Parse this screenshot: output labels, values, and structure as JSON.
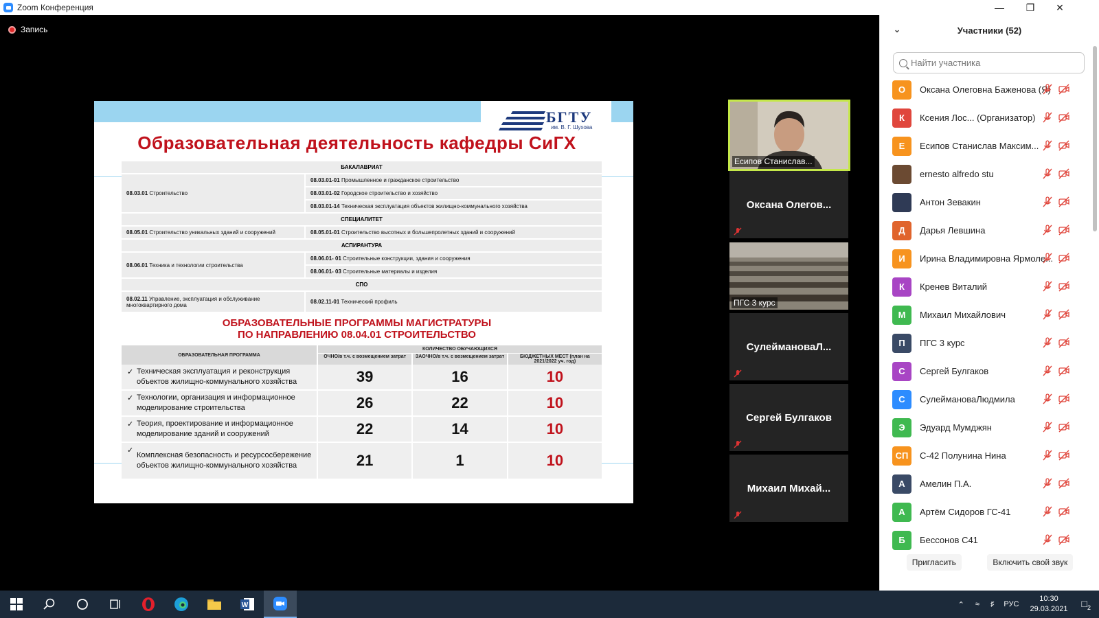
{
  "window": {
    "title": "Zoom Конференция"
  },
  "recording": {
    "label": "Запись"
  },
  "slide": {
    "logo_name": "БГТУ",
    "logo_sub": "им. В. Г. Шухова",
    "title": "Образовательная деятельность кафедры СиГХ",
    "sections": {
      "bachelor": "БАКАЛАВРИАТ",
      "specialist": "СПЕЦИАЛИТЕТ",
      "postgrad": "АСПИРАНТУРА",
      "spo": "СПО"
    },
    "bachelor": {
      "left": {
        "code": "08.03.01",
        "name": "Строительство"
      },
      "right": [
        {
          "code": "08.03.01-01",
          "name": "Промышленное и гражданское строительство"
        },
        {
          "code": "08.03.01-02",
          "name": "Городское строительство и хозяйство"
        },
        {
          "code": "08.03.01-14",
          "name": "Техническая эксплуатация объектов жилищно-коммунального хозяйства"
        }
      ]
    },
    "specialist": {
      "left": {
        "code": "08.05.01",
        "name": "Строительство уникальных зданий и сооружений"
      },
      "right": [
        {
          "code": "08.05.01-01",
          "name": "Строительство высотных и большепролетных зданий и сооружений"
        }
      ]
    },
    "postgrad": {
      "left": {
        "code": "08.06.01",
        "name": "Техника и технологии строительства"
      },
      "right": [
        {
          "code": "08.06.01- 01",
          "name": "Строительные конструкции, здания и сооружения"
        },
        {
          "code": "08.06.01- 03",
          "name": "Строительные материалы и изделия"
        }
      ]
    },
    "spo": {
      "left": {
        "code": "08.02.11",
        "name": "Управление, эксплуатация и обслуживание многоквартирного дома"
      },
      "right": [
        {
          "code": "08.02.11-01",
          "name": "Технический профиль"
        }
      ]
    },
    "subtitle_line1": "ОБРАЗОВАТЕЛЬНЫЕ ПРОГРАММЫ МАГИСТРАТУРЫ",
    "subtitle_line2": "ПО НАПРАВЛЕНИЮ 08.04.01 СТРОИТЕЛЬСТВО",
    "masters_table": {
      "col_program": "ОБРАЗОВАТЕЛЬНАЯ ПРОГРАММА",
      "col_group": "КОЛИЧЕСТВО ОБУЧАЮЩИХСЯ",
      "col_full": "ОЧНО/в т.ч. с возмещением затрат",
      "col_part": "ЗАОЧНО/в т.ч. с возмещением затрат",
      "col_budget": "БЮДЖЕТНЫХ МЕСТ (план на 2021/2022 уч. год)",
      "rows": [
        {
          "program": "Техническая эксплуатация и реконструкция объектов жилищно-коммунального хозяйства",
          "full": "39",
          "part": "16",
          "budget": "10"
        },
        {
          "program": "Технологии, организация и информационное моделирование строительства",
          "full": "26",
          "part": "22",
          "budget": "10"
        },
        {
          "program": "Теория, проектирование и информационное моделирование зданий и сооружений",
          "full": "22",
          "part": "14",
          "budget": "10"
        },
        {
          "program": "Комплексная безопасность и ресурсосбережение объектов жилищно-коммунального хозяйства",
          "full": "21",
          "part": "1",
          "budget": "10"
        }
      ]
    }
  },
  "tiles": {
    "active_label": "Есипов Станислав...",
    "t2": "Оксана  Олегов...",
    "t3_label": "ПГС 3 курс",
    "t4": "СулеймановаЛ...",
    "t5": "Сергей Булгаков",
    "t6": "Михаил  Михай..."
  },
  "participants_panel": {
    "title": "Участники (52)",
    "search_placeholder": "Найти участника",
    "invite": "Пригласить",
    "unmute": "Включить свой звук",
    "list": [
      {
        "initial": "О",
        "color": "#f7931e",
        "name": "Оксана Олеговна Баженова (Я)"
      },
      {
        "initial": "К",
        "color": "#e0463c",
        "name": "Ксения Лос... (Организатор)"
      },
      {
        "initial": "Е",
        "color": "#f7931e",
        "name": "Есипов Станислав Максим..."
      },
      {
        "initial": "",
        "color": "#6b4a32",
        "name": "ernesto alfredo stu"
      },
      {
        "initial": "",
        "color": "#2f3a55",
        "name": "Антон Зевакин"
      },
      {
        "initial": "Д",
        "color": "#e0642c",
        "name": "Дарья Левшина"
      },
      {
        "initial": "И",
        "color": "#f7931e",
        "name": "Ирина Владимировна Ярмоле..."
      },
      {
        "initial": "К",
        "color": "#a845c4",
        "name": "Кренев Виталий"
      },
      {
        "initial": "М",
        "color": "#3fb950",
        "name": "Михаил Михайлович"
      },
      {
        "initial": "П",
        "color": "#3a4a66",
        "name": "ПГС 3 курс"
      },
      {
        "initial": "С",
        "color": "#a845c4",
        "name": "Сергей Булгаков"
      },
      {
        "initial": "С",
        "color": "#2d8cff",
        "name": "СулеймановаЛюдмила"
      },
      {
        "initial": "Э",
        "color": "#3fb950",
        "name": "Эдуард Мумджян"
      },
      {
        "initial": "СП",
        "color": "#f7931e",
        "name": "С-42 Полунина Нина"
      },
      {
        "initial": "А",
        "color": "#3a4a66",
        "name": "Амелин П.А."
      },
      {
        "initial": "А",
        "color": "#3fb950",
        "name": "Артём Сидоров ГС-41"
      },
      {
        "initial": "Б",
        "color": "#3fb950",
        "name": "Бессонов С41"
      }
    ]
  },
  "taskbar": {
    "lang": "РУС",
    "time": "10:30",
    "date": "29.03.2021",
    "notifications": "2"
  }
}
